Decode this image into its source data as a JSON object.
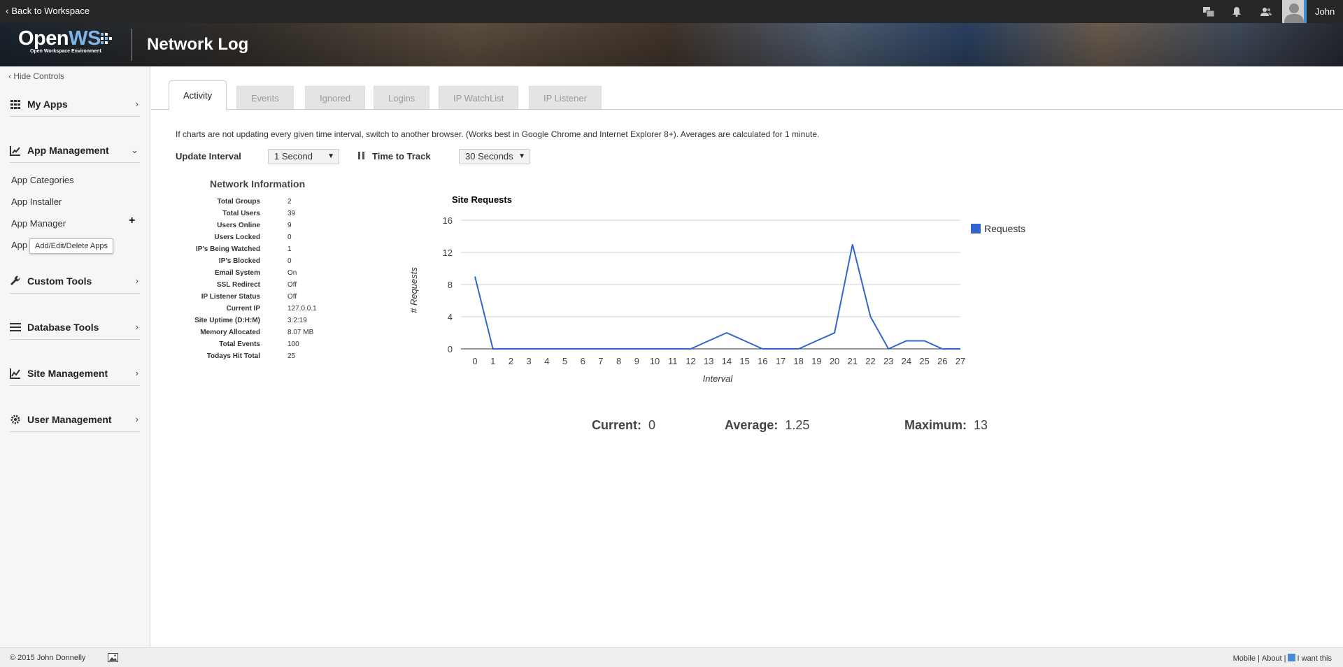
{
  "topbar": {
    "back_label": "Back to Workspace",
    "username": "John",
    "icons": [
      "windows-icon",
      "bell-icon",
      "users-icon",
      "avatar"
    ]
  },
  "banner": {
    "logo_text_open": "Open",
    "logo_text_ws": "WS",
    "logo_subtitle": "Open Workspace Environment",
    "page_title": "Network Log"
  },
  "sidebar": {
    "hide_controls": "Hide Controls",
    "sections": [
      {
        "label": "My Apps",
        "icon": "grid-icon",
        "expanded": false
      },
      {
        "label": "App Management",
        "icon": "chart-edit-icon",
        "expanded": true
      },
      {
        "label": "Custom Tools",
        "icon": "wrench-icon",
        "expanded": false
      },
      {
        "label": "Database Tools",
        "icon": "list-icon",
        "expanded": false
      },
      {
        "label": "Site Management",
        "icon": "line-chart-icon",
        "expanded": false
      },
      {
        "label": "User Management",
        "icon": "users-gear-icon",
        "expanded": false
      }
    ],
    "app_management_items": [
      "App Categories",
      "App Installer",
      "App Manager",
      "App"
    ],
    "tooltip": "Add/Edit/Delete Apps"
  },
  "tabs": [
    {
      "label": "Activity",
      "active": true
    },
    {
      "label": "Events",
      "active": false
    },
    {
      "label": "Ignored",
      "active": false
    },
    {
      "label": "Logins",
      "active": false
    },
    {
      "label": "IP WatchList",
      "active": false
    },
    {
      "label": "IP Listener",
      "active": false
    }
  ],
  "notice": "If charts are not updating every given time interval, switch to another browser. (Works best in Google Chrome and Internet Explorer 8+). Averages are calculated for 1 minute.",
  "controls": {
    "update_interval_label": "Update Interval",
    "update_interval_value": "1 Second",
    "time_to_track_label": "Time to Track",
    "time_to_track_value": "30 Seconds"
  },
  "network_info": {
    "title": "Network Information",
    "rows": [
      {
        "key": "Total Groups",
        "value": "2"
      },
      {
        "key": "Total Users",
        "value": "39"
      },
      {
        "key": "Users Online",
        "value": "9"
      },
      {
        "key": "Users Locked",
        "value": "0"
      },
      {
        "key": "IP's Being Watched",
        "value": "1"
      },
      {
        "key": "IP's Blocked",
        "value": "0"
      },
      {
        "key": "Email System",
        "value": "On"
      },
      {
        "key": "SSL Redirect",
        "value": "Off"
      },
      {
        "key": "IP Listener Status",
        "value": "Off"
      },
      {
        "key": "Current IP",
        "value": "127.0.0.1"
      },
      {
        "key": "Site Uptime (D:H:M)",
        "value": "3:2:19"
      },
      {
        "key": "Memory Allocated",
        "value": "8.07 MB"
      },
      {
        "key": "Total Events",
        "value": "100"
      },
      {
        "key": "Todays Hit Total",
        "value": "25"
      }
    ]
  },
  "chart_data": {
    "type": "line",
    "title": "Site Requests",
    "xlabel": "Interval",
    "ylabel": "# Requests",
    "ylim": [
      0,
      16
    ],
    "yticks": [
      0,
      4,
      8,
      12,
      16
    ],
    "grid": true,
    "legend_position": "right",
    "x": [
      0,
      1,
      2,
      3,
      4,
      5,
      6,
      7,
      8,
      9,
      10,
      11,
      12,
      13,
      14,
      15,
      16,
      17,
      18,
      19,
      20,
      21,
      22,
      23,
      24,
      25,
      26,
      27
    ],
    "series": [
      {
        "name": "Requests",
        "color": "#3366cc",
        "values": [
          9,
          0,
          0,
          0,
          0,
          0,
          0,
          0,
          0,
          0,
          0,
          0,
          0,
          1,
          2,
          1,
          0,
          0,
          0,
          1,
          2,
          13,
          4,
          0,
          1,
          1,
          0,
          0
        ]
      }
    ]
  },
  "stats": {
    "current_label": "Current:",
    "current_value": "0",
    "average_label": "Average:",
    "average_value": "1.25",
    "maximum_label": "Maximum:",
    "maximum_value": "13"
  },
  "footer": {
    "copyright": "© 2015 John Donnelly",
    "links": [
      "Mobile",
      "About",
      "I want this"
    ]
  }
}
